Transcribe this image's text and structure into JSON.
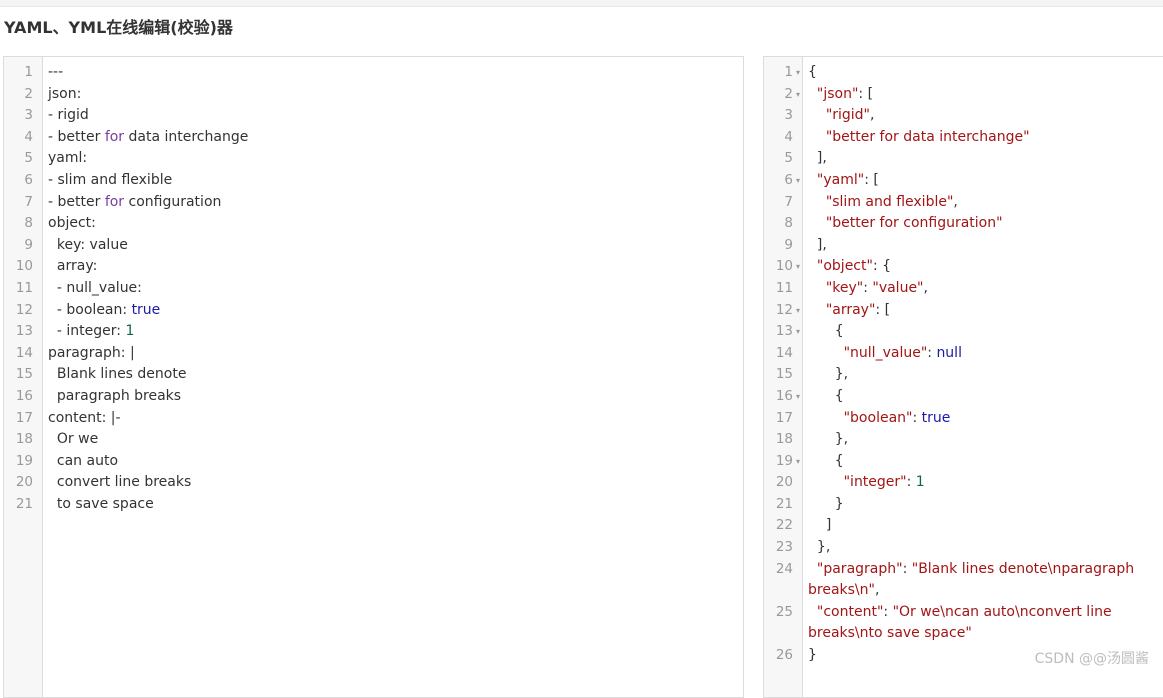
{
  "page": {
    "title": "YAML、YML在线编辑(校验)器",
    "watermark": "CSDN @@汤圆酱"
  },
  "yaml_editor": {
    "lines": [
      {
        "n": "1",
        "t": [
          {
            "c": "",
            "v": "---"
          }
        ]
      },
      {
        "n": "2",
        "t": [
          {
            "c": "",
            "v": "json:"
          }
        ]
      },
      {
        "n": "3",
        "t": [
          {
            "c": "",
            "v": "- rigid"
          }
        ]
      },
      {
        "n": "4",
        "t": [
          {
            "c": "",
            "v": "- better "
          },
          {
            "c": "kw",
            "v": "for"
          },
          {
            "c": "",
            "v": " data interchange"
          }
        ]
      },
      {
        "n": "5",
        "t": [
          {
            "c": "",
            "v": "yaml:"
          }
        ]
      },
      {
        "n": "6",
        "t": [
          {
            "c": "",
            "v": "- slim and flexible"
          }
        ]
      },
      {
        "n": "7",
        "t": [
          {
            "c": "",
            "v": "- better "
          },
          {
            "c": "kw",
            "v": "for"
          },
          {
            "c": "",
            "v": " configuration"
          }
        ]
      },
      {
        "n": "8",
        "t": [
          {
            "c": "",
            "v": "object:"
          }
        ]
      },
      {
        "n": "9",
        "t": [
          {
            "c": "",
            "v": "  key: value"
          }
        ]
      },
      {
        "n": "10",
        "t": [
          {
            "c": "",
            "v": "  array:"
          }
        ]
      },
      {
        "n": "11",
        "t": [
          {
            "c": "",
            "v": "  - null_value:"
          }
        ]
      },
      {
        "n": "12",
        "t": [
          {
            "c": "",
            "v": "  - boolean: "
          },
          {
            "c": "bool",
            "v": "true"
          }
        ]
      },
      {
        "n": "13",
        "t": [
          {
            "c": "",
            "v": "  - integer: "
          },
          {
            "c": "num",
            "v": "1"
          }
        ]
      },
      {
        "n": "14",
        "t": [
          {
            "c": "",
            "v": "paragraph: |"
          }
        ]
      },
      {
        "n": "15",
        "t": [
          {
            "c": "",
            "v": "  Blank lines denote"
          }
        ]
      },
      {
        "n": "16",
        "t": [
          {
            "c": "",
            "v": "  paragraph breaks"
          }
        ]
      },
      {
        "n": "17",
        "t": [
          {
            "c": "",
            "v": "content: |-"
          }
        ]
      },
      {
        "n": "18",
        "t": [
          {
            "c": "",
            "v": "  Or we"
          }
        ]
      },
      {
        "n": "19",
        "t": [
          {
            "c": "",
            "v": "  can auto"
          }
        ]
      },
      {
        "n": "20",
        "t": [
          {
            "c": "",
            "v": "  convert line breaks"
          }
        ]
      },
      {
        "n": "21",
        "t": [
          {
            "c": "",
            "v": "  to save space"
          }
        ]
      }
    ]
  },
  "json_editor": {
    "lines": [
      {
        "n": "1",
        "fold": true,
        "t": [
          {
            "c": "",
            "v": "{"
          }
        ]
      },
      {
        "n": "2",
        "fold": true,
        "t": [
          {
            "c": "",
            "v": "  "
          },
          {
            "c": "jkey",
            "v": "\"json\""
          },
          {
            "c": "",
            "v": ": ["
          }
        ]
      },
      {
        "n": "3",
        "t": [
          {
            "c": "",
            "v": "    "
          },
          {
            "c": "str",
            "v": "\"rigid\""
          },
          {
            "c": "",
            "v": ","
          }
        ]
      },
      {
        "n": "4",
        "t": [
          {
            "c": "",
            "v": "    "
          },
          {
            "c": "str",
            "v": "\"better for data interchange\""
          }
        ]
      },
      {
        "n": "5",
        "t": [
          {
            "c": "",
            "v": "  ],"
          }
        ]
      },
      {
        "n": "6",
        "fold": true,
        "t": [
          {
            "c": "",
            "v": "  "
          },
          {
            "c": "jkey",
            "v": "\"yaml\""
          },
          {
            "c": "",
            "v": ": ["
          }
        ]
      },
      {
        "n": "7",
        "t": [
          {
            "c": "",
            "v": "    "
          },
          {
            "c": "str",
            "v": "\"slim and flexible\""
          },
          {
            "c": "",
            "v": ","
          }
        ]
      },
      {
        "n": "8",
        "t": [
          {
            "c": "",
            "v": "    "
          },
          {
            "c": "str",
            "v": "\"better for configuration\""
          }
        ]
      },
      {
        "n": "9",
        "t": [
          {
            "c": "",
            "v": "  ],"
          }
        ]
      },
      {
        "n": "10",
        "fold": true,
        "t": [
          {
            "c": "",
            "v": "  "
          },
          {
            "c": "jkey",
            "v": "\"object\""
          },
          {
            "c": "",
            "v": ": {"
          }
        ]
      },
      {
        "n": "11",
        "t": [
          {
            "c": "",
            "v": "    "
          },
          {
            "c": "jkey",
            "v": "\"key\""
          },
          {
            "c": "",
            "v": ": "
          },
          {
            "c": "str",
            "v": "\"value\""
          },
          {
            "c": "",
            "v": ","
          }
        ]
      },
      {
        "n": "12",
        "fold": true,
        "t": [
          {
            "c": "",
            "v": "    "
          },
          {
            "c": "jkey",
            "v": "\"array\""
          },
          {
            "c": "",
            "v": ": ["
          }
        ]
      },
      {
        "n": "13",
        "fold": true,
        "t": [
          {
            "c": "",
            "v": "      {"
          }
        ]
      },
      {
        "n": "14",
        "t": [
          {
            "c": "",
            "v": "        "
          },
          {
            "c": "jkey",
            "v": "\"null_value\""
          },
          {
            "c": "",
            "v": ": "
          },
          {
            "c": "nul",
            "v": "null"
          }
        ]
      },
      {
        "n": "15",
        "t": [
          {
            "c": "",
            "v": "      },"
          }
        ]
      },
      {
        "n": "16",
        "fold": true,
        "t": [
          {
            "c": "",
            "v": "      {"
          }
        ]
      },
      {
        "n": "17",
        "t": [
          {
            "c": "",
            "v": "        "
          },
          {
            "c": "jkey",
            "v": "\"boolean\""
          },
          {
            "c": "",
            "v": ": "
          },
          {
            "c": "bool",
            "v": "true"
          }
        ]
      },
      {
        "n": "18",
        "t": [
          {
            "c": "",
            "v": "      },"
          }
        ]
      },
      {
        "n": "19",
        "fold": true,
        "t": [
          {
            "c": "",
            "v": "      {"
          }
        ]
      },
      {
        "n": "20",
        "t": [
          {
            "c": "",
            "v": "        "
          },
          {
            "c": "jkey",
            "v": "\"integer\""
          },
          {
            "c": "",
            "v": ": "
          },
          {
            "c": "num",
            "v": "1"
          }
        ]
      },
      {
        "n": "21",
        "t": [
          {
            "c": "",
            "v": "      }"
          }
        ]
      },
      {
        "n": "22",
        "t": [
          {
            "c": "",
            "v": "    ]"
          }
        ]
      },
      {
        "n": "23",
        "t": [
          {
            "c": "",
            "v": "  },"
          }
        ]
      },
      {
        "n": "24",
        "wrap": true,
        "t": [
          {
            "c": "",
            "v": "  "
          },
          {
            "c": "jkey",
            "v": "\"paragraph\""
          },
          {
            "c": "",
            "v": ": "
          },
          {
            "c": "str",
            "v": "\"Blank lines denote\\nparagraph breaks\\n\""
          },
          {
            "c": "",
            "v": ","
          }
        ]
      },
      {
        "n": "25",
        "wrap": true,
        "t": [
          {
            "c": "",
            "v": "  "
          },
          {
            "c": "jkey",
            "v": "\"content\""
          },
          {
            "c": "",
            "v": ": "
          },
          {
            "c": "str",
            "v": "\"Or we\\ncan auto\\nconvert line breaks\\nto save space\""
          }
        ]
      },
      {
        "n": "26",
        "t": [
          {
            "c": "",
            "v": "}"
          }
        ]
      }
    ]
  }
}
